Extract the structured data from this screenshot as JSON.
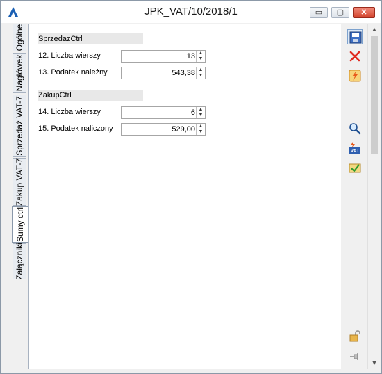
{
  "window": {
    "title": "JPK_VAT/10/2018/1",
    "controls": {
      "minimize": "▭",
      "maximize": "▢",
      "close": "✕"
    }
  },
  "tabs": [
    {
      "label": "Ogólne"
    },
    {
      "label": "Nagłówek"
    },
    {
      "label": "Sprzedaż VAT-7"
    },
    {
      "label": "Zakup VAT-7"
    },
    {
      "label": "Sumy ctrl"
    },
    {
      "label": "Załączniki"
    }
  ],
  "sales": {
    "header": "SprzedazCtrl",
    "rows": [
      {
        "label": "12. Liczba wierszy",
        "value": "13"
      },
      {
        "label": "13. Podatek należny",
        "value": "543,38"
      }
    ]
  },
  "purchases": {
    "header": "ZakupCtrl",
    "rows": [
      {
        "label": "14. Liczba wierszy",
        "value": "6"
      },
      {
        "label": "15. Podatek naliczony",
        "value": "529,00"
      }
    ]
  },
  "toolbar": {
    "icons": [
      "save-icon",
      "cancel-icon",
      "lightning-icon",
      "magnifier-icon",
      "vat-icon",
      "approve-icon",
      "unlock-icon",
      "pin-icon"
    ]
  },
  "colors": {
    "active_tab": "#ffffff",
    "section_bg": "#e8e8e8",
    "close_button": "#d2432c"
  }
}
